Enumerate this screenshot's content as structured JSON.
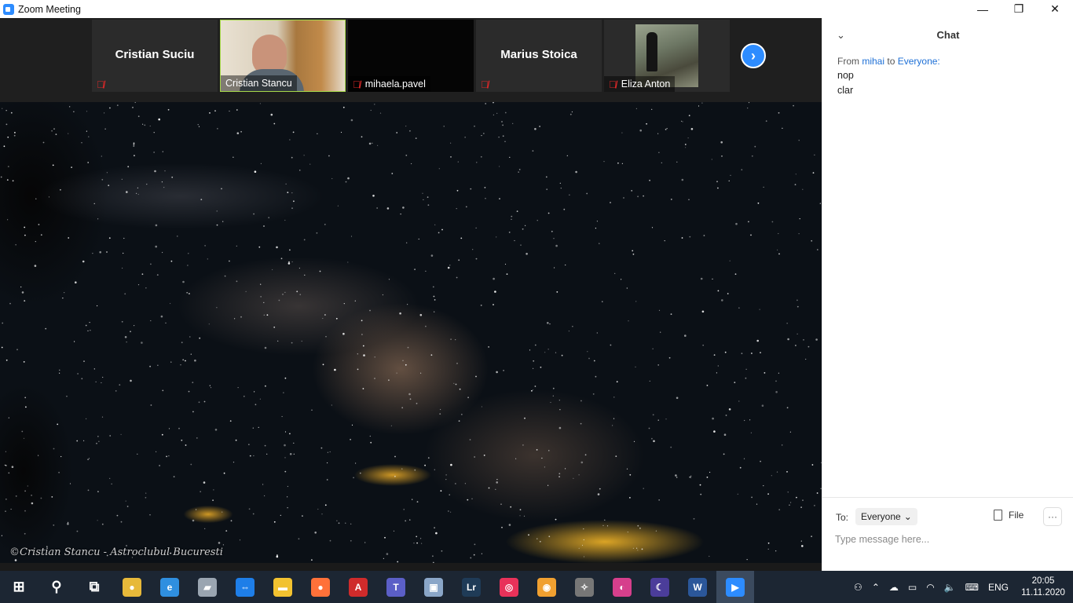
{
  "window": {
    "title": "Zoom Meeting",
    "controls": {
      "minimize": "—",
      "restore": "❐",
      "close": "✕"
    }
  },
  "participants": [
    {
      "name": "Cristian Suciu",
      "show_name_center": true,
      "mic_muted": true
    },
    {
      "name": "Cristian Stancu",
      "camera_on": true,
      "active_speaker": true,
      "mic_muted": false
    },
    {
      "name": "mihaela.pavel",
      "mic_muted": true
    },
    {
      "name": "Marius Stoica",
      "show_name_center": true,
      "mic_muted": true
    },
    {
      "name": "Eliza Anton",
      "has_photo": true,
      "mic_muted": true
    }
  ],
  "strip": {
    "next_icon": "chevron-right-icon",
    "next_glyph": "›"
  },
  "share": {
    "watermark": "©Cristian Stancu - Astroclubul Bucuresti"
  },
  "chat": {
    "title": "Chat",
    "collapse_glyph": "⌄",
    "messages": [
      {
        "from_prefix": "From",
        "from": "mihai",
        "to_prefix": "to",
        "to": "Everyone:",
        "lines": [
          "nop",
          "clar"
        ]
      }
    ],
    "to_label": "To:",
    "recipient": "Everyone",
    "file_label": "File",
    "more_glyph": "···",
    "input_placeholder": "Type message here..."
  },
  "taskbar": {
    "apps": [
      {
        "name": "start-icon",
        "glyph": "⊞",
        "color": "#ffffff"
      },
      {
        "name": "search-icon",
        "glyph": "⚲",
        "color": "#ffffff"
      },
      {
        "name": "task-view-icon",
        "glyph": "⧉",
        "color": "#ffffff"
      },
      {
        "name": "chrome-icon",
        "glyph": "●",
        "color": "#e7b93a"
      },
      {
        "name": "edge-icon",
        "glyph": "e",
        "color": "#2f8fe0"
      },
      {
        "name": "app-icon",
        "glyph": "▰",
        "color": "#9aa5b1"
      },
      {
        "name": "teamviewer-icon",
        "glyph": "⇔",
        "color": "#1e7ee8"
      },
      {
        "name": "file-explorer-icon",
        "glyph": "▬",
        "color": "#f2c230"
      },
      {
        "name": "firefox-icon",
        "glyph": "●",
        "color": "#ff7139"
      },
      {
        "name": "acrobat-icon",
        "glyph": "A",
        "color": "#cf2b2b"
      },
      {
        "name": "teams-icon",
        "glyph": "T",
        "color": "#5b5fc7"
      },
      {
        "name": "photos-icon",
        "glyph": "▣",
        "color": "#8aa6c8"
      },
      {
        "name": "lightroom-icon",
        "glyph": "Lr",
        "color": "#1f3b57"
      },
      {
        "name": "creative-cloud-icon",
        "glyph": "◎",
        "color": "#e8325a"
      },
      {
        "name": "camera-app-icon",
        "glyph": "◉",
        "color": "#f0a030"
      },
      {
        "name": "app-icon-2",
        "glyph": "✧",
        "color": "#777777"
      },
      {
        "name": "color-app-icon",
        "glyph": "◐",
        "color": "#d63f8c"
      },
      {
        "name": "stellarium-icon",
        "glyph": "☾",
        "color": "#4b3d9a"
      },
      {
        "name": "word-icon",
        "glyph": "W",
        "color": "#2b579a"
      },
      {
        "name": "zoom-icon",
        "glyph": "▶",
        "color": "#2d8cff",
        "active": true
      }
    ],
    "tray": {
      "people_glyph": "⚇",
      "chevron_glyph": "⌃",
      "onedrive_glyph": "☁",
      "battery_glyph": "▭",
      "wifi_glyph": "◠",
      "volume_glyph": "🔈",
      "keyboard_glyph": "⌨",
      "language": "ENG",
      "time": "20:05",
      "date": "11.11.2020"
    }
  }
}
